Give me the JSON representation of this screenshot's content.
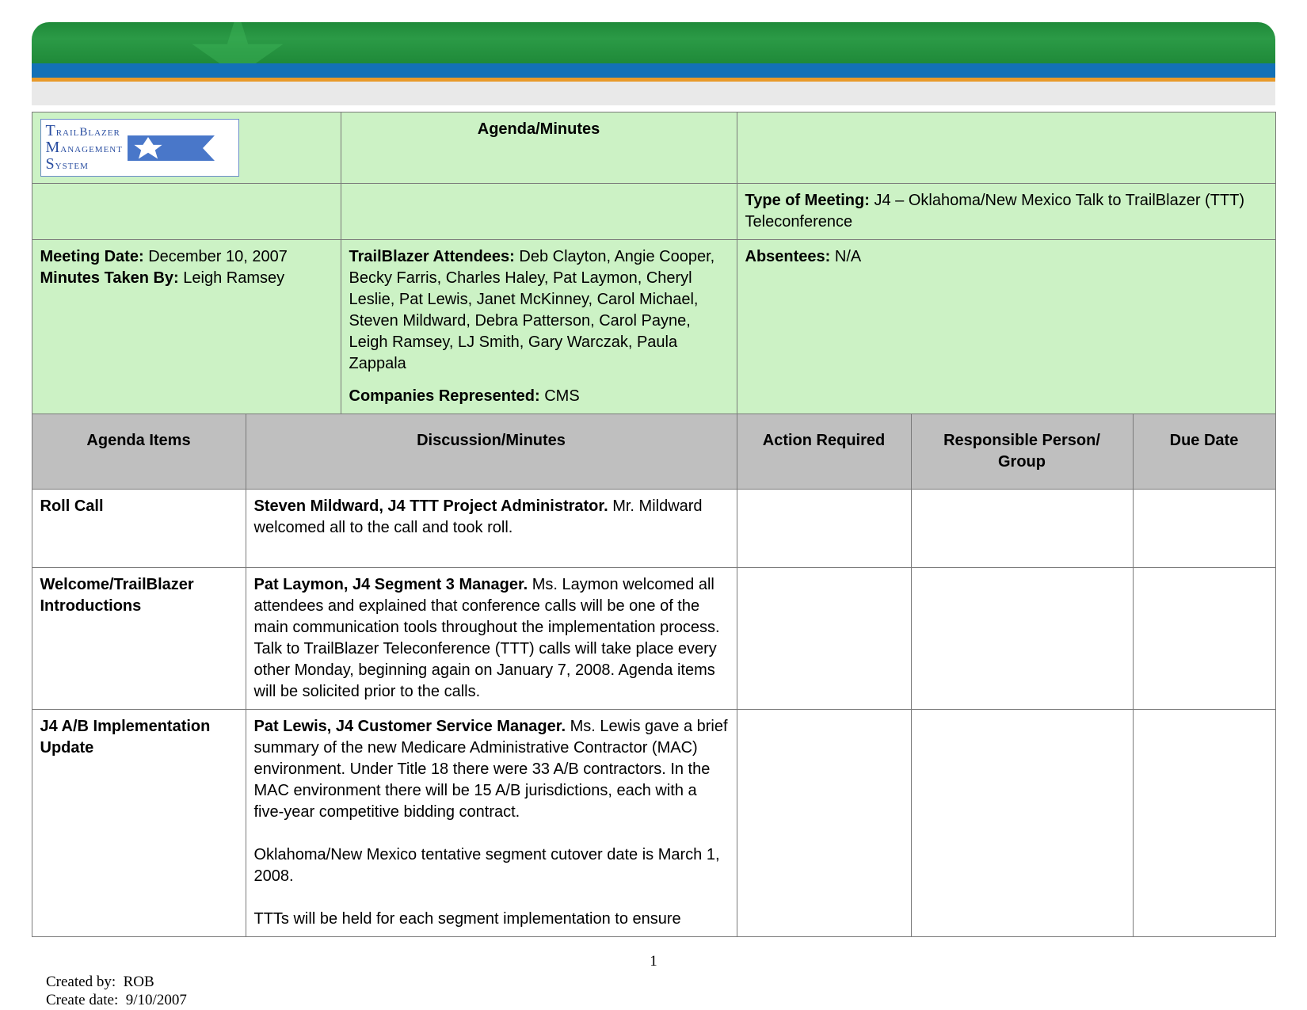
{
  "logo": {
    "line1": "TrailBlazer",
    "line2": "Management",
    "line3": "System"
  },
  "header": {
    "title": "Agenda/Minutes"
  },
  "meta": {
    "meeting_type_label": "Type of Meeting:",
    "meeting_type_value": "J4 – Oklahoma/New Mexico Talk to TrailBlazer (TTT) Teleconference",
    "date_label": "Meeting Date:",
    "date_value": "December 10, 2007",
    "taker_label": "Minutes Taken By:",
    "taker_value": "Leigh Ramsey",
    "attendees_label": "TrailBlazer Attendees:",
    "attendees_value": "Deb Clayton, Angie Cooper, Becky Farris, Charles Haley, Pat Laymon, Cheryl Leslie, Pat Lewis, Janet McKinney, Carol Michael, Steven Mildward, Debra Patterson, Carol Payne, Leigh Ramsey, LJ Smith, Gary Warczak, Paula Zappala",
    "companies_label": "Companies Represented:",
    "companies_value": "CMS",
    "absentees_label": "Absentees:",
    "absentees_value": "N/A"
  },
  "columns": {
    "c1": "Agenda Items",
    "c2": "Discussion/Minutes",
    "c3": "Action Required",
    "c4": "Responsible Person/ Group",
    "c5": "Due Date"
  },
  "rows": [
    {
      "item": "Roll Call",
      "lead": "Steven Mildward, J4 TTT Project Administrator.",
      "text": " Mr. Mildward welcomed all to the call and took roll.",
      "action": "",
      "resp": "",
      "due": ""
    },
    {
      "item": "Welcome/TrailBlazer Introductions",
      "lead": "Pat Laymon, J4 Segment 3 Manager.",
      "text": " Ms. Laymon welcomed all attendees and explained that conference calls will be one of the main communication tools throughout the implementation process. Talk to TrailBlazer Teleconference (TTT) calls will take place every other Monday, beginning again on January 7, 2008. Agenda items will be solicited prior to the calls.",
      "action": "",
      "resp": "",
      "due": ""
    },
    {
      "item": "J4 A/B Implementation Update",
      "lead": "Pat Lewis, J4 Customer Service Manager.",
      "text": " Ms. Lewis gave a brief summary of the new Medicare Administrative Contractor (MAC) environment. Under Title 18 there were 33 A/B contractors. In the MAC environment there will be 15 A/B jurisdictions, each with a five-year competitive bidding contract.\n\nOklahoma/New Mexico tentative segment cutover date is March 1, 2008.\n\nTTTs will be held for each segment implementation to ensure",
      "action": "",
      "resp": "",
      "due": ""
    }
  ],
  "footer": {
    "page_number": "1",
    "created_by_label": "Created by:",
    "created_by_value": "ROB",
    "create_date_label": "Create date:",
    "create_date_value": "9/10/2007"
  }
}
